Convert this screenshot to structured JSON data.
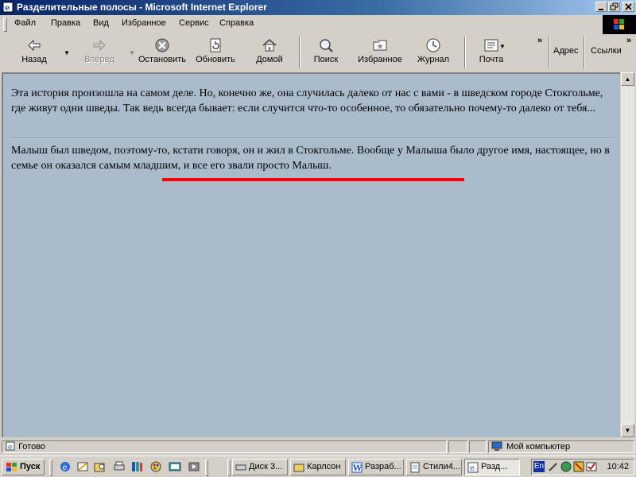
{
  "window": {
    "title": "Разделительные полосы - Microsoft Internet Explorer"
  },
  "menu": [
    {
      "label": "Файл"
    },
    {
      "label": "Правка"
    },
    {
      "label": "Вид"
    },
    {
      "label": "Избранное"
    },
    {
      "label": "Сервис"
    },
    {
      "label": "Справка"
    }
  ],
  "toolbar": {
    "back": "Назад",
    "forward": "Вперед",
    "stop": "Остановить",
    "refresh": "Обновить",
    "home": "Домой",
    "search": "Поиск",
    "favorites": "Избранное",
    "history": "Журнал",
    "mail": "Почта",
    "address_label": "Адрес",
    "links_label": "Ссылки",
    "chevron": "»"
  },
  "page": {
    "paragraph1": "Эта история произошла на самом деле. Но, конечно же, она случилась далеко от нас с вами - в шведском городе Стокгольме, где живут одни шведы. Так ведь всегда бывает: если случится что-то особенное, то обязательно почему-то далеко от тебя...",
    "paragraph2": "Малыш был шведом, поэтому-то, кстати говоря, он и жил в Стокгольме. Вообще у Малыша было другое имя, настоящее, но в семье он оказался самым младшим, и все его звали просто Малыш.",
    "highlight_color": "#ff0000",
    "background_color": "#aabbcc"
  },
  "status": {
    "text": "Готово",
    "zone": "Мой компьютер"
  },
  "taskbar": {
    "start": "Пуск",
    "tasks": [
      {
        "label": "Диск 3..."
      },
      {
        "label": "Карлсон"
      },
      {
        "label": "Разраб..."
      },
      {
        "label": "Стили4..."
      },
      {
        "label": "Разд..."
      }
    ],
    "language": "En",
    "clock": "10:42"
  }
}
